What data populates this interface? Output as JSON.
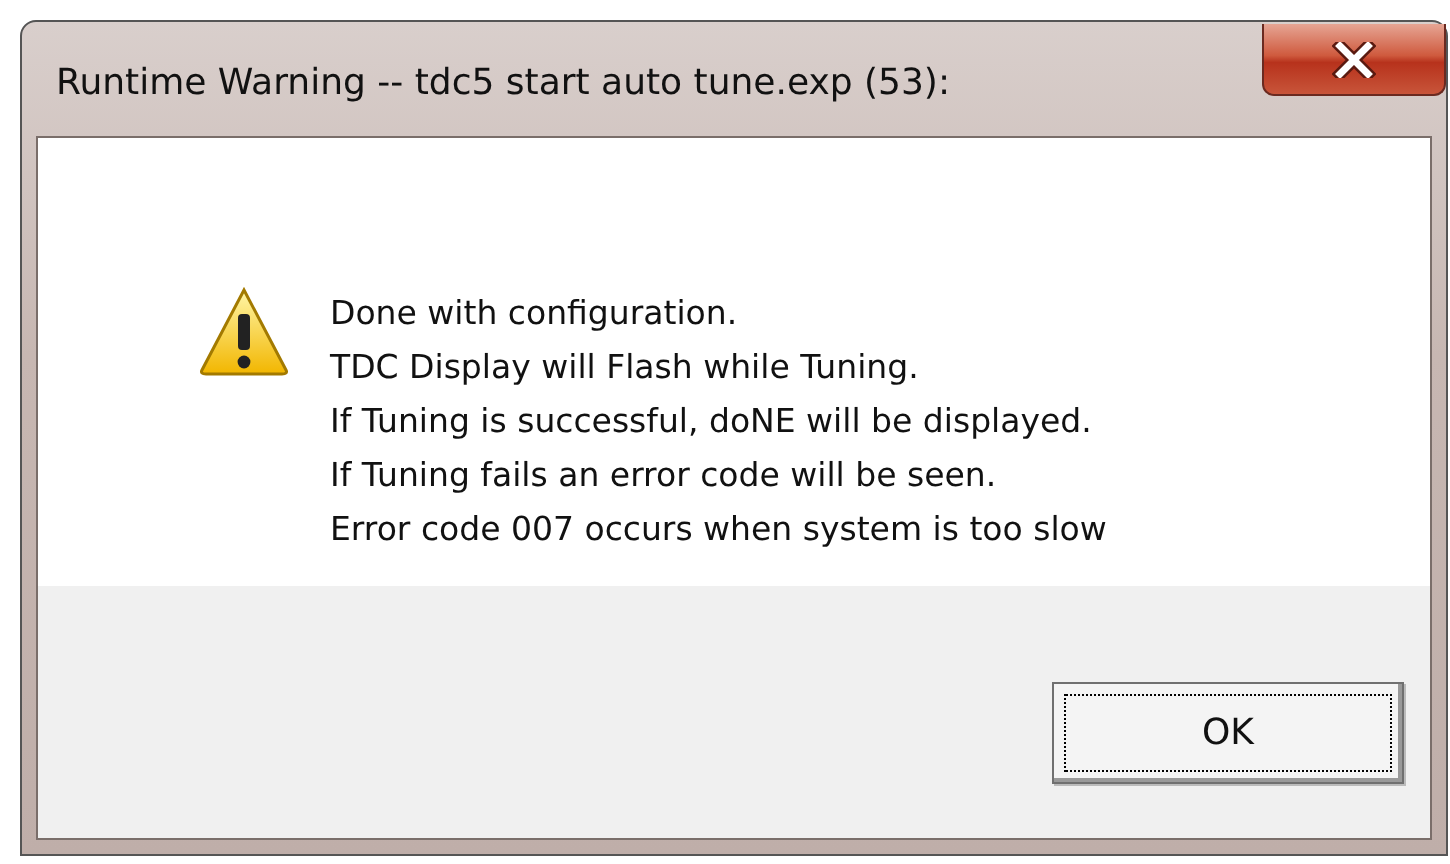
{
  "window": {
    "title": "Runtime Warning -- tdc5 start auto tune.exp (53):"
  },
  "message": {
    "lines": [
      "Done with configuration.",
      "TDC Display will Flash while Tuning.",
      "If Tuning is successful, doNE will be displayed.",
      "If Tuning fails an error code will be seen.",
      "Error code 007 occurs when system is too slow"
    ]
  },
  "buttons": [
    {
      "label": "OK",
      "focused": true
    }
  ]
}
